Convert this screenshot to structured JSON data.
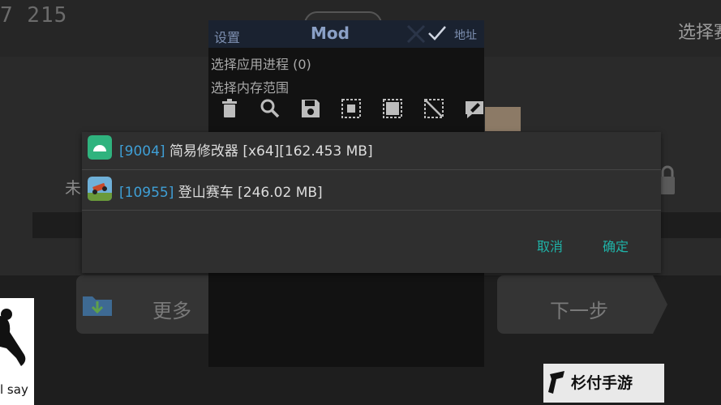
{
  "background": {
    "score": "7 215",
    "select_label": "选择赛",
    "unlocked_char": "未",
    "more_button": "更多",
    "next_button": "下一步"
  },
  "gg_panel": {
    "tab_settings": "设置",
    "title": "Mod",
    "tab_address": "地址",
    "select_process": "选择应用进程 (0)",
    "select_memory_range": "选择内存范围",
    "toolbar_icons": [
      "trash-icon",
      "search-icon",
      "save-icon",
      "select-region-icon",
      "chip-icon",
      "crop-off-icon",
      "edit-icon"
    ]
  },
  "process_dialog": {
    "processes": [
      {
        "pid": "[9004]",
        "name": "简易修改器 [x64][162.453 MB]",
        "icon": "android-icon",
        "color": "#2fb37e"
      },
      {
        "pid": "[10955]",
        "name": "登山赛车 [246.02 MB]",
        "icon": "hill-climb-app-icon",
        "color": "#c94a2a"
      }
    ],
    "cancel_label": "取消",
    "confirm_label": "确定"
  },
  "overlays": {
    "thumb_caption": "l say",
    "watermark": "杉付手游"
  },
  "colors": {
    "accent": "#1fb3a8",
    "pid": "#3f9fd6"
  }
}
